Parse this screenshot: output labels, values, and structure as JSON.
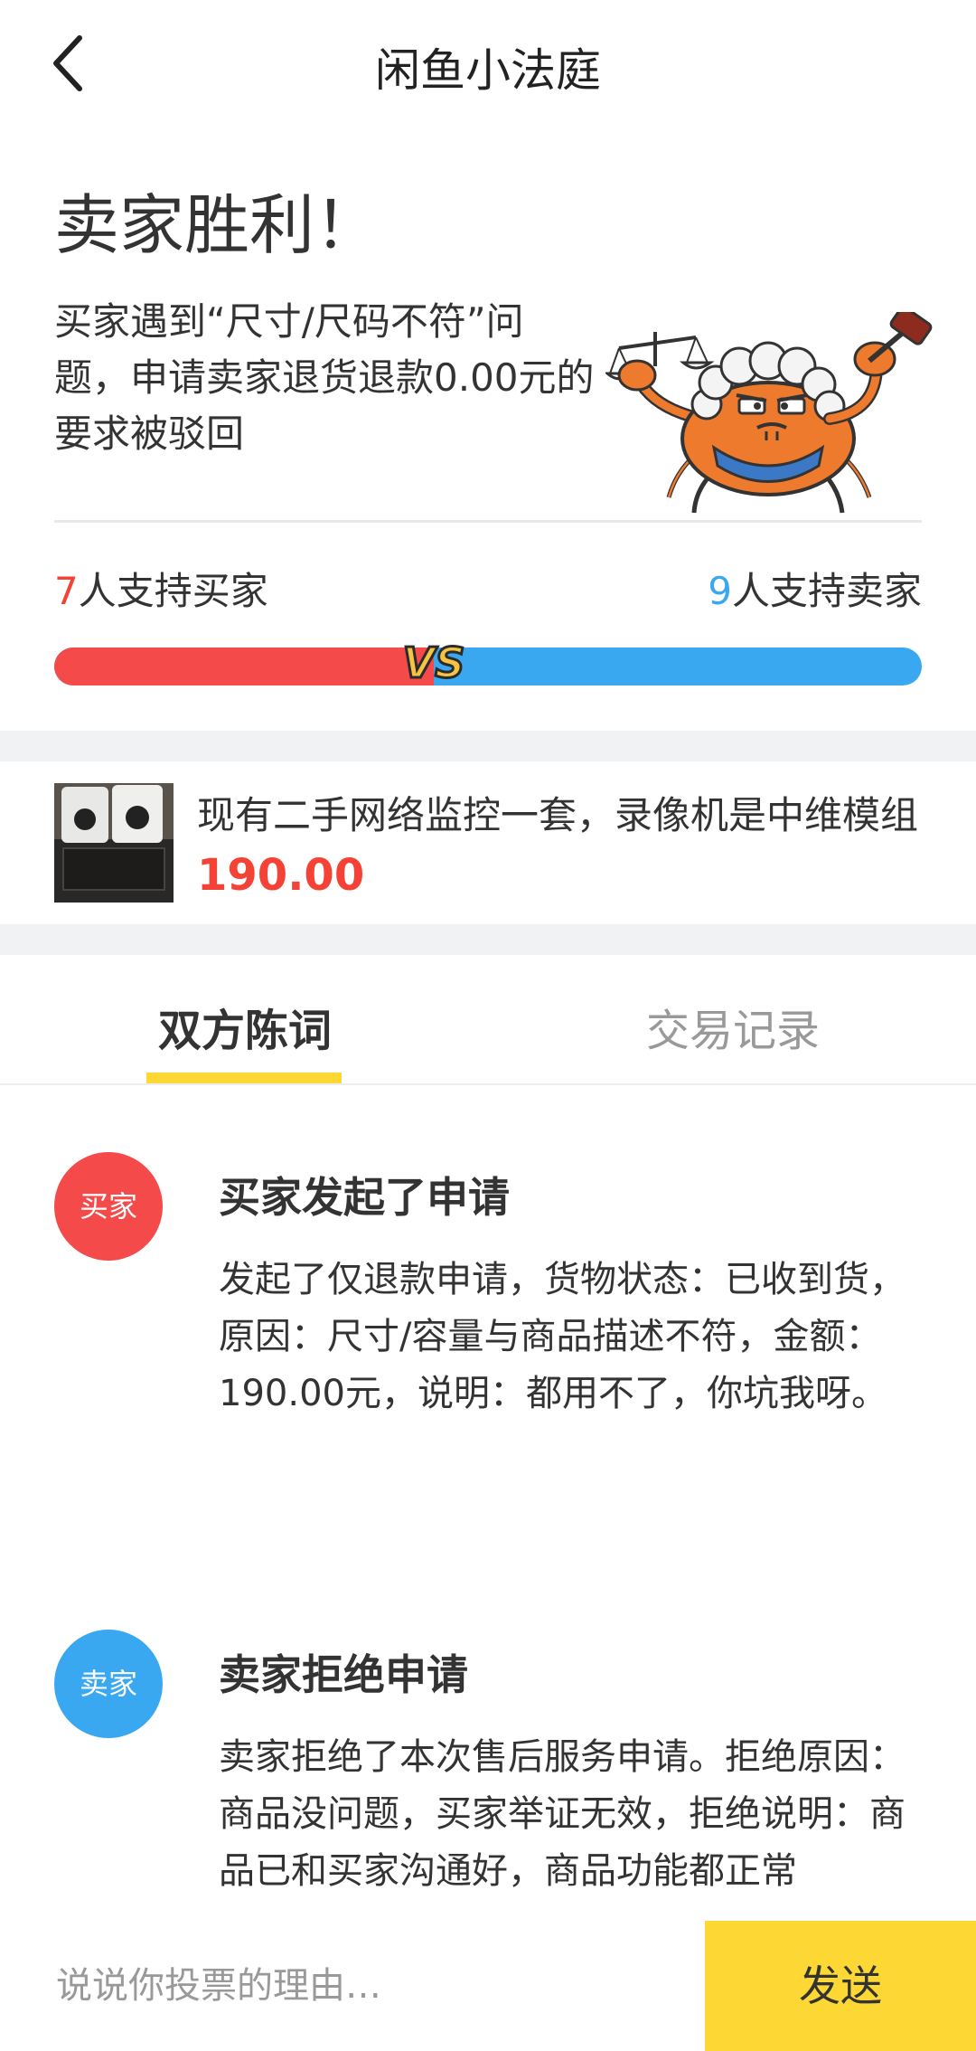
{
  "header": {
    "title": "闲鱼小法庭",
    "back_icon": "chevron-left-icon"
  },
  "verdict": {
    "title": "卖家胜利！",
    "description": "买家遇到“尺寸/尺码不符”问题，申请卖家退货退款0.00元的要求被驳回"
  },
  "votes": {
    "buyer_count": "7",
    "buyer_label": "人支持买家",
    "seller_count": "9",
    "seller_label": "人支持卖家",
    "buyer_share": 0.4375,
    "vs_label": "VS",
    "colors": {
      "buyer": "#f44a4a",
      "seller": "#3aa8f0",
      "vs": "#f6c342"
    }
  },
  "product": {
    "title": "现有二手网络监控一套，录像机是中维模组",
    "price": "190.00"
  },
  "tabs": [
    {
      "label": "双方陈词",
      "active": true
    },
    {
      "label": "交易记录",
      "active": false
    }
  ],
  "timeline": [
    {
      "role": "买家",
      "title": "买家发起了申请",
      "body": "发起了仅退款申请，货物状态：已收到货，原因：尺寸/容量与商品描述不符，金额：190.00元，说明：都用不了，你坑我呀。"
    },
    {
      "role": "卖家",
      "title": "卖家拒绝申请",
      "body": "卖家拒绝了本次售后服务申请。拒绝原因：商品没问题，买家举证无效，拒绝说明：商品已和买家沟通好，商品功能都正常"
    }
  ],
  "footer": {
    "input_placeholder": "说说你投票的理由…",
    "send_label": "发送"
  },
  "colors": {
    "accent": "#fdd835",
    "price": "#f44336"
  }
}
